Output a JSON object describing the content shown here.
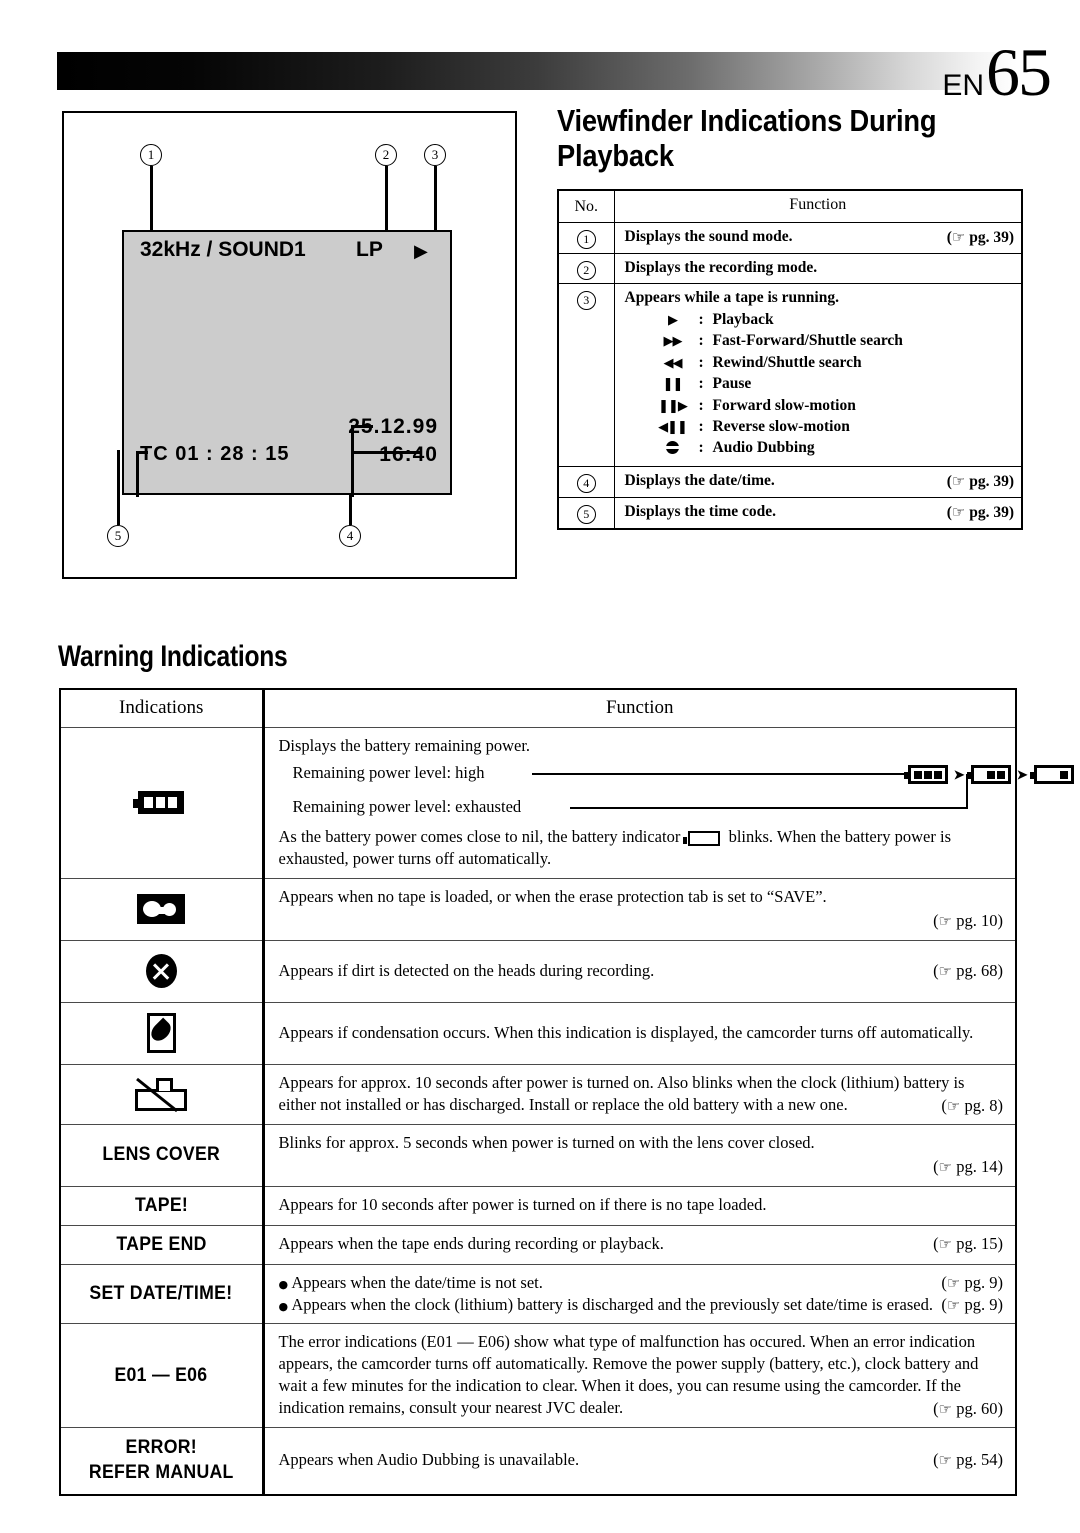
{
  "header": {
    "lang": "EN",
    "page_number": "65"
  },
  "viewfinder": {
    "callouts": [
      "1",
      "2",
      "3",
      "4",
      "5"
    ],
    "sound_mode": "32kHz / SOUND1",
    "recording_mode": "LP",
    "tape_status_icon": "▶",
    "time_code": "TC  01 : 28 : 15",
    "date": "25.12.99",
    "time": "16:40"
  },
  "section1": {
    "title": "Viewfinder Indications During Playback",
    "table": {
      "headers": [
        "No.",
        "Function"
      ],
      "rows": [
        {
          "no": "1",
          "text": "Displays the sound mode.",
          "pg": "pg. 39"
        },
        {
          "no": "2",
          "text": "Displays the recording mode.",
          "pg": ""
        },
        {
          "no": "3",
          "text": "Appears while a tape is running.",
          "pg": "",
          "modes": [
            {
              "glyph": "▶",
              "label": "Playback"
            },
            {
              "glyph": "▶▶",
              "label": "Fast-Forward/Shuttle search"
            },
            {
              "glyph": "◀◀",
              "label": "Rewind/Shuttle search"
            },
            {
              "glyph": "❚❚",
              "label": "Pause"
            },
            {
              "glyph": "❚❚▶",
              "label": "Forward slow-motion"
            },
            {
              "glyph": "◀❚❚",
              "label": "Reverse slow-motion"
            },
            {
              "glyph": "audio-dub-icon",
              "label": "Audio Dubbing"
            }
          ]
        },
        {
          "no": "4",
          "text": "Displays the date/time.",
          "pg": "pg. 39"
        },
        {
          "no": "5",
          "text": "Displays the time code.",
          "pg": "pg. 39"
        }
      ]
    }
  },
  "section2": {
    "title": "Warning Indications",
    "headers": [
      "Indications",
      "Function"
    ],
    "rows": [
      {
        "icon": "battery-icon",
        "label": "",
        "lines": [
          "Displays the battery remaining power.",
          "Remaining power level: high",
          "Remaining power level: exhausted",
          "As the battery power comes close to nil, the battery indicator",
          "blinks. When the battery power is exhausted, power turns off automatically."
        ],
        "pg": ""
      },
      {
        "icon": "tape-icon",
        "label": "",
        "text": "Appears when no tape is loaded, or when the erase protection tab is set to “SAVE”.",
        "pg": "pg. 10"
      },
      {
        "icon": "dirty-head-icon",
        "label": "",
        "text": "Appears if dirt is detected on the heads during recording.",
        "pg": "pg. 68"
      },
      {
        "icon": "condensation-icon",
        "label": "",
        "text": "Appears if condensation occurs. When this indication is displayed, the camcorder turns off automatically.",
        "pg": ""
      },
      {
        "icon": "lithium-battery-icon",
        "label": "",
        "text": "Appears for approx. 10 seconds after power is turned on. Also blinks when the clock (lithium) battery is either not installed or has discharged. Install or replace the old battery with a new one.",
        "pg": "pg. 8"
      },
      {
        "icon": "",
        "label": "LENS COVER",
        "text": "Blinks for approx. 5 seconds when power is turned on with the lens cover closed.",
        "pg": "pg. 14"
      },
      {
        "icon": "",
        "label": "TAPE!",
        "text": "Appears for 10 seconds after power is turned on if there is no tape loaded.",
        "pg": ""
      },
      {
        "icon": "",
        "label": "TAPE END",
        "text": "Appears when the tape ends during recording or playback.",
        "pg": "pg. 15"
      },
      {
        "icon": "",
        "label": "SET DATE/TIME!",
        "bullets": [
          {
            "text": "Appears when the date/time is not set.",
            "pg": "pg. 9"
          },
          {
            "text": "Appears when the clock (lithium) battery is discharged and the previously set date/time is erased.",
            "pg": "pg. 9"
          }
        ],
        "pg": ""
      },
      {
        "icon": "",
        "label": "E01 — E06",
        "text": "The error indications (E01 — E06) show what type of malfunction has occured. When an error indication appears, the camcorder turns off automatically. Remove the power supply (battery, etc.), clock battery and wait a few minutes for the indication to clear. When it does, you can resume using the camcorder. If the indication remains, consult your nearest JVC dealer.",
        "pg": "pg. 60"
      },
      {
        "icon": "",
        "label": "ERROR!\nREFER MANUAL",
        "label_line1": "ERROR!",
        "label_line2": "REFER MANUAL",
        "text": "Appears when Audio Dubbing is unavailable.",
        "pg": "pg. 54"
      }
    ]
  }
}
